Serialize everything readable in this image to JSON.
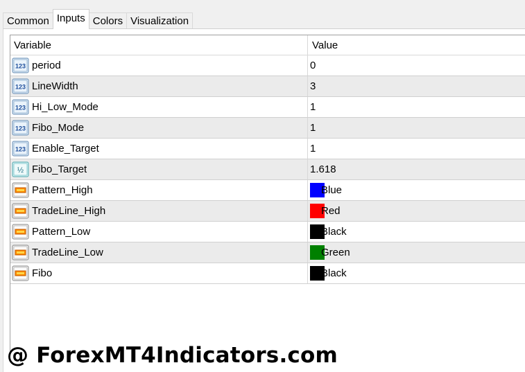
{
  "tabs": [
    {
      "label": "Common",
      "active": false
    },
    {
      "label": "Inputs",
      "active": true
    },
    {
      "label": "Colors",
      "active": false
    },
    {
      "label": "Visualization",
      "active": false
    }
  ],
  "table": {
    "headers": {
      "variable": "Variable",
      "value": "Value"
    },
    "rows": [
      {
        "name": "period",
        "value": "0",
        "icon": "integer-icon"
      },
      {
        "name": "LineWidth",
        "value": "3",
        "icon": "integer-icon"
      },
      {
        "name": "Hi_Low_Mode",
        "value": "1",
        "icon": "integer-icon"
      },
      {
        "name": "Fibo_Mode",
        "value": "1",
        "icon": "integer-icon"
      },
      {
        "name": "Enable_Target",
        "value": "1",
        "icon": "integer-icon"
      },
      {
        "name": "Fibo_Target",
        "value": "1.618",
        "icon": "double-icon"
      },
      {
        "name": "Pattern_High",
        "value": "Blue",
        "icon": "color-icon",
        "color": "#0000ff"
      },
      {
        "name": "TradeLine_High",
        "value": "Red",
        "icon": "color-icon",
        "color": "#ff0000"
      },
      {
        "name": "Pattern_Low",
        "value": "Black",
        "icon": "color-icon",
        "color": "#000000"
      },
      {
        "name": "TradeLine_Low",
        "value": "Green",
        "icon": "color-icon",
        "color": "#008000"
      },
      {
        "name": "Fibo",
        "value": "Black",
        "icon": "color-icon",
        "color": "#000000"
      }
    ]
  },
  "watermark": "@ ForexMT4Indicators.com"
}
